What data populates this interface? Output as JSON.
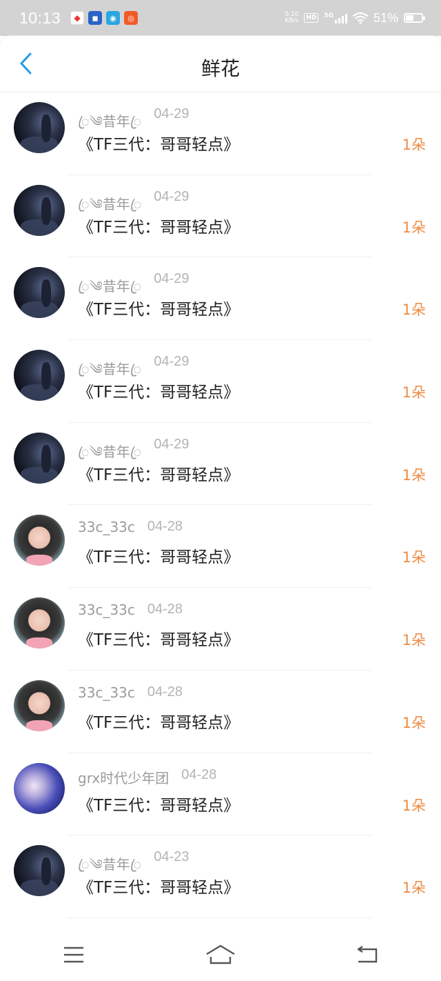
{
  "status_bar": {
    "time": "10:13",
    "net_speed_value": "0.10",
    "net_speed_unit": "KB/s",
    "hd_label": "HD",
    "network_label": "5G",
    "battery_percent": "51%",
    "battery_level": 0.51
  },
  "header": {
    "title": "鲜花"
  },
  "colors": {
    "accent_blue": "#1e9be8",
    "quantity_orange": "#ee8b45",
    "status_bar_bg": "#d3d3d3"
  },
  "records": [
    {
      "name": "ꦿ༄昔年ꦿ",
      "date": "04-29",
      "book": "《TF三代：哥哥轻点》",
      "quantity": "1朵",
      "avatar": "night-scene"
    },
    {
      "name": "ꦿ༄昔年ꦿ",
      "date": "04-29",
      "book": "《TF三代：哥哥轻点》",
      "quantity": "1朵",
      "avatar": "night-scene"
    },
    {
      "name": "ꦿ༄昔年ꦿ",
      "date": "04-29",
      "book": "《TF三代：哥哥轻点》",
      "quantity": "1朵",
      "avatar": "night-scene"
    },
    {
      "name": "ꦿ༄昔年ꦿ",
      "date": "04-29",
      "book": "《TF三代：哥哥轻点》",
      "quantity": "1朵",
      "avatar": "night-scene"
    },
    {
      "name": "ꦿ༄昔年ꦿ",
      "date": "04-29",
      "book": "《TF三代：哥哥轻点》",
      "quantity": "1朵",
      "avatar": "night-scene"
    },
    {
      "name": "33c_33c",
      "date": "04-28",
      "book": "《TF三代：哥哥轻点》",
      "quantity": "1朵",
      "avatar": "girl-portrait"
    },
    {
      "name": "33c_33c",
      "date": "04-28",
      "book": "《TF三代：哥哥轻点》",
      "quantity": "1朵",
      "avatar": "girl-portrait"
    },
    {
      "name": "33c_33c",
      "date": "04-28",
      "book": "《TF三代：哥哥轻点》",
      "quantity": "1朵",
      "avatar": "girl-portrait"
    },
    {
      "name": "grx时代少年团",
      "date": "04-28",
      "book": "《TF三代：哥哥轻点》",
      "quantity": "1朵",
      "avatar": "blue-portrait"
    },
    {
      "name": "ꦿ༄昔年ꦿ",
      "date": "04-23",
      "book": "《TF三代：哥哥轻点》",
      "quantity": "1朵",
      "avatar": "night-scene"
    }
  ],
  "nav_bar": {
    "icons": [
      "menu-icon",
      "home-icon",
      "back-icon"
    ]
  }
}
